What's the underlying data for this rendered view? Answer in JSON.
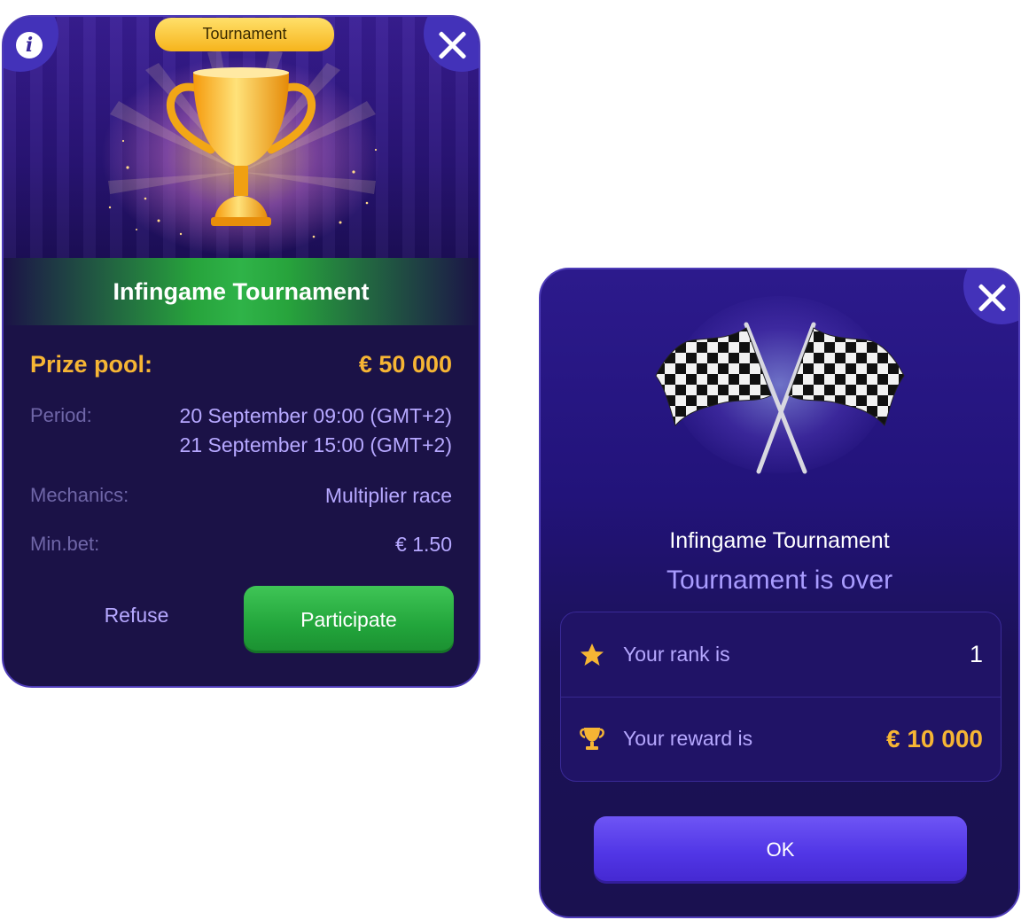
{
  "join_dialog": {
    "tab_label": "Tournament",
    "info_icon": "i",
    "title": "Infingame Tournament",
    "prize_pool_label": "Prize pool:",
    "prize_pool_value": "€ 50 000",
    "period_label": "Period:",
    "period_start": "20 September 09:00 (GMT+2)",
    "period_end": "21 September 15:00 (GMT+2)",
    "mechanics_label": "Mechanics:",
    "mechanics_value": "Multiplier race",
    "min_bet_label": "Min.bet:",
    "min_bet_value": "€ 1.50",
    "refuse_label": "Refuse",
    "participate_label": "Participate"
  },
  "result_dialog": {
    "title": "Infingame Tournament",
    "subtitle": "Tournament  is over",
    "rank_label": "Your rank is",
    "rank_value": "1",
    "reward_label": "Your reward is",
    "reward_value": "€ 10 000",
    "ok_label": "OK"
  },
  "colors": {
    "card_bg": "#1b1247",
    "accent_gold": "#f6b534",
    "accent_lavender": "#b6a8ff",
    "participate_green": "#22a53b",
    "ok_purple": "#5136e6"
  },
  "icons": [
    "info-icon",
    "close-icon",
    "trophy-icon",
    "checkered-flags-icon",
    "star-icon"
  ]
}
